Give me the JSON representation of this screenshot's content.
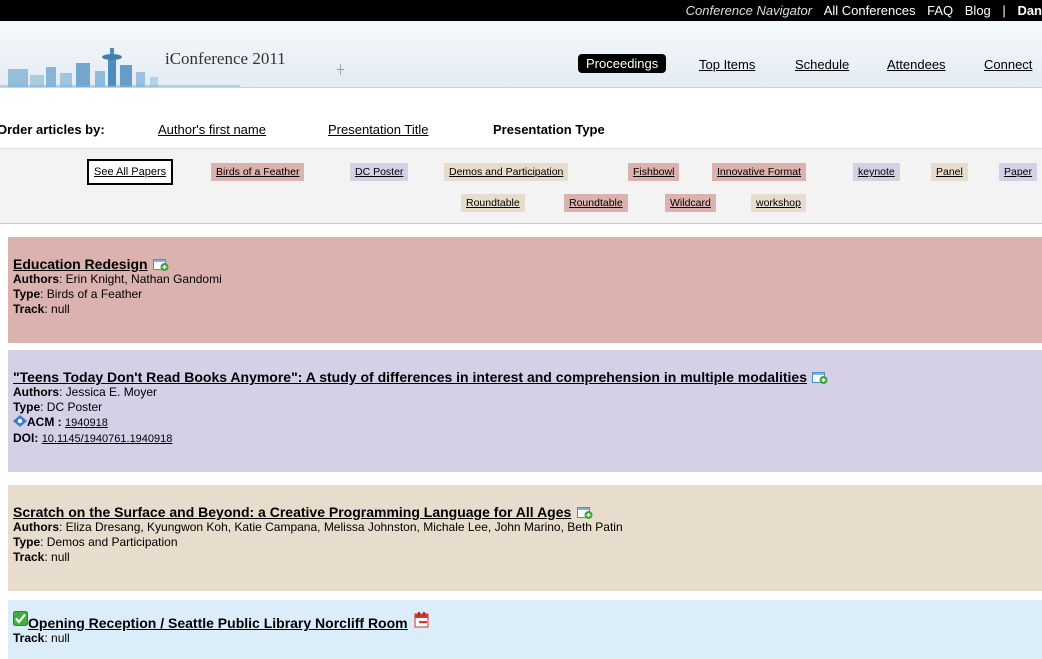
{
  "topnav": {
    "conference_navigator": "Conference Navigator",
    "all_conferences": "All Conferences",
    "faq": "FAQ",
    "blog": "Blog",
    "separator": "|",
    "user": "Dan"
  },
  "header": {
    "logo_text": "iConference 2011",
    "nav": {
      "proceedings": "Proceedings",
      "top_items": "Top Items",
      "schedule": "Schedule",
      "attendees": "Attendees",
      "connect": "Connect"
    }
  },
  "order": {
    "label": "Order articles by:",
    "author": "Author's first name",
    "title": "Presentation Title",
    "type": "Presentation Type"
  },
  "filters": {
    "see_all": "See All Papers",
    "birds": "Birds of a Feather",
    "dc_poster": "DC Poster",
    "demos": "Demos and Participation",
    "fishbowl": "Fishbowl",
    "innovative": "Innovative Format",
    "keynote": "keynote",
    "panel": "Panel",
    "paper": "Paper",
    "roundtable1": "Roundtable",
    "roundtable2": "Roundtable",
    "wildcard": "Wildcard",
    "workshop": "workshop"
  },
  "labels": {
    "authors": "Authors",
    "type": "Type",
    "track": "Track",
    "acm": "ACM :",
    "doi": "DOI:"
  },
  "items": [
    {
      "title": "Education Redesign",
      "authors": ": Erin Knight, Nathan Gandomi",
      "type": ": Birds of a Feather",
      "track": ": null"
    },
    {
      "title": "\"Teens Today Don't Read Books Anymore\": A study of differences in interest and comprehension in multiple modalities",
      "authors": ": Jessica E. Moyer",
      "type": ": DC Poster",
      "acm": "1940918",
      "doi": "10.1145/1940761.1940918"
    },
    {
      "title": "Scratch on the Surface and Beyond: a Creative Programming Language for All Ages",
      "authors": ": Eliza Dresang, Kyungwon Koh, Katie Campana, Melissa Johnston, Michale Lee, John Marino, Beth Patin",
      "type": ": Demos and Participation",
      "track": ": null"
    },
    {
      "title": "Opening Reception / Seattle Public Library Norcliff Room",
      "track": ": null"
    }
  ],
  "colors": {
    "birds": "#dbb2ad",
    "dc_poster": "#d5d0e6",
    "demos": "#e8dccc",
    "event": "#dcedfa"
  }
}
